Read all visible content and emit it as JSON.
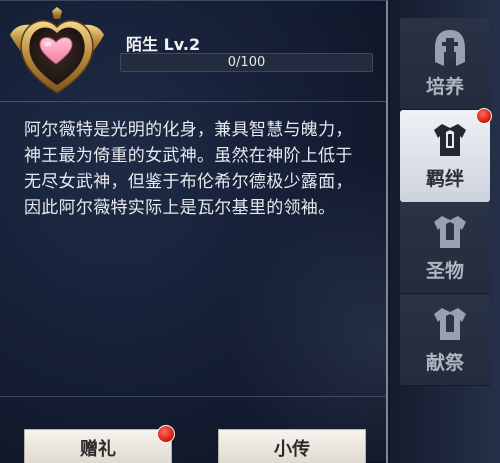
{
  "bond": {
    "title": "陌生 Lv.2",
    "progress_text": "0/100",
    "progress_fraction": 0,
    "description": "阿尔薇特是光明的化身，兼具智慧与魄力，神王最为倚重的女武神。虽然在神阶上低于无尽女武神，但鉴于布伦希尔德极少露面，因此阿尔薇特实际上是瓦尔基里的领袖。",
    "emblem_icon": "heart-icon"
  },
  "buttons": {
    "gift_label": "赠礼",
    "bio_label": "小传"
  },
  "sidebar": {
    "tabs": [
      {
        "label": "培养",
        "icon": "helmet-icon",
        "active": false
      },
      {
        "label": "羁绊",
        "icon": "armor-icon",
        "active": true
      },
      {
        "label": "圣物",
        "icon": "armor-icon",
        "active": false
      },
      {
        "label": "献祭",
        "icon": "armor-icon",
        "active": false
      }
    ]
  },
  "colors": {
    "accent_gold": "#c9a860",
    "notification_red": "#d0180f",
    "active_tab": "#e6eaf1"
  }
}
